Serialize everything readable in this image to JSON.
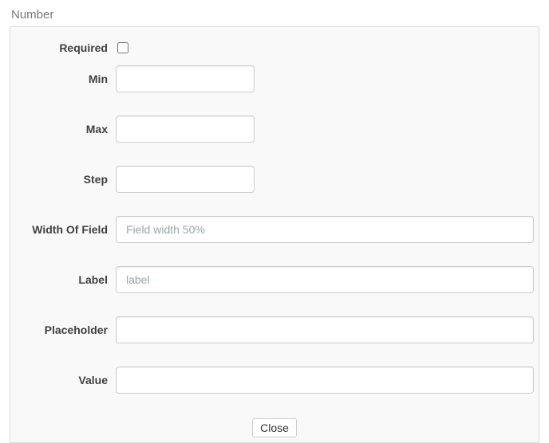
{
  "section": {
    "title": "Number"
  },
  "labels": {
    "required": "Required",
    "min": "Min",
    "max": "Max",
    "step": "Step",
    "width": "Width Of Field",
    "label": "Label",
    "placeholder": "Placeholder",
    "value": "Value"
  },
  "fields": {
    "required": false,
    "min": "",
    "max": "",
    "step": "",
    "width": "",
    "label": "",
    "placeholder": "",
    "value": ""
  },
  "placeholders": {
    "width": "Field width 50%",
    "label": "label"
  },
  "footer": {
    "close_label": "Close"
  }
}
